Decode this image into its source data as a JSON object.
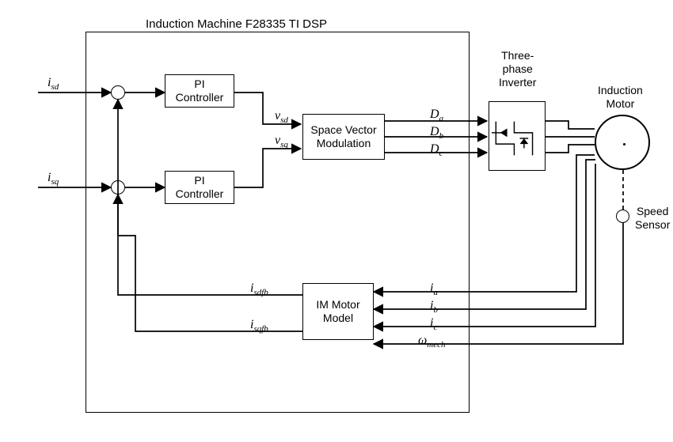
{
  "title": "Induction Machine F28335 TI DSP",
  "blocks": {
    "pi1": "PI\nController",
    "pi2": "PI\nController",
    "svm": "Space Vector\nModulation",
    "mdl": "IM Motor\nModel",
    "inv": "Three-\nphase\nInverter",
    "motor": "Induction\nMotor",
    "sensor": "Speed\nSensor"
  },
  "signals": {
    "isd": "i_sd",
    "isq": "i_sq",
    "vsd": "v_sd",
    "vsq": "v_sq",
    "Da": "D_a",
    "Db": "D_b",
    "Dc": "D_c",
    "ia": "i_a",
    "ib": "i_b",
    "ic": "i_c",
    "wmech": "ω_mech",
    "isdfb": "i_sdfb",
    "isqfb": "i_sqfb"
  }
}
